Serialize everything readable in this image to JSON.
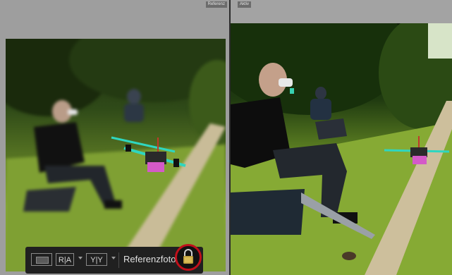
{
  "panes": {
    "left": {
      "tag": "Referenz"
    },
    "right": {
      "tag": "Aktiv"
    }
  },
  "toolbar": {
    "view_mode_icon": "single-view-icon",
    "ra_icon": "ra-compare-icon",
    "yy_icon": "yy-compare-icon",
    "ra_glyphs": "R|A",
    "yy_glyphs": "Y|Y",
    "label": "Referenzfoto",
    "lock_icon": "padlock-icon",
    "lock_ring_color": "#c0101b"
  },
  "colors": {
    "canvas": "#9e9e9e",
    "toolbar": "#202020",
    "drone_arms": "#2fd6c0",
    "drone_battery": "#d45ac8"
  }
}
